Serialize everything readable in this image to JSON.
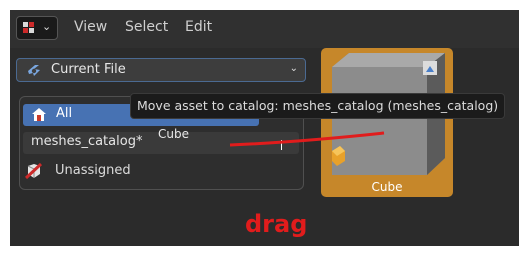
{
  "header": {
    "menus": [
      "View",
      "Select",
      "Edit"
    ]
  },
  "library_selector": {
    "value": "Current File"
  },
  "catalogs": {
    "all_label": "All",
    "catalog_item": "meshes_catalog*",
    "unassigned_label": "Unassigned"
  },
  "tooltip": {
    "text": "Move asset to catalog: meshes_catalog (meshes_catalog)"
  },
  "drag_label": "Cube",
  "asset": {
    "name": "Cube"
  },
  "annotation": {
    "text": "drag",
    "color": "#e11c1c"
  },
  "colors": {
    "selected": "#4772b3",
    "asset_highlight": "#c6872a"
  }
}
